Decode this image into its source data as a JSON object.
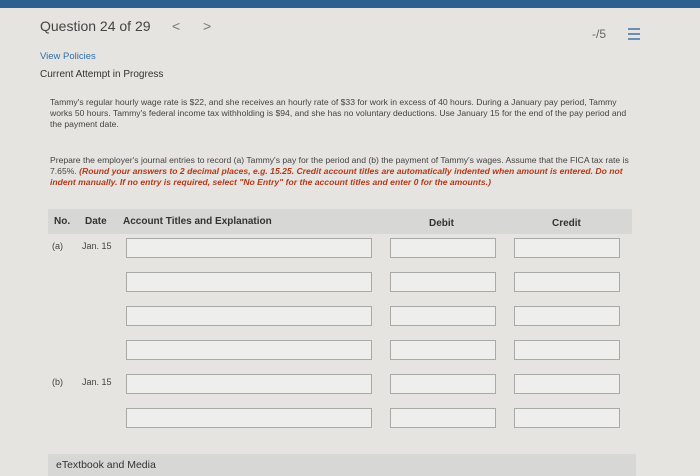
{
  "question": {
    "title": "Question 24 of 29",
    "prev_icon": "<",
    "next_icon": ">",
    "score": "-/5",
    "menu_icon": "list-icon"
  },
  "links": {
    "view_policies": "View Policies"
  },
  "status": {
    "attempt": "Current Attempt in Progress"
  },
  "problem": {
    "paragraph1": "Tammy's regular hourly wage rate is $22, and she receives an hourly rate of $33 for work in excess of 40 hours. During a January pay period, Tammy works 50 hours. Tammy's federal income tax withholding is $94, and she has no voluntary deductions. Use January 15 for the end of the pay period and the payment date.",
    "paragraph2_plain": "Prepare the employer's journal entries to record (a) Tammy's pay for the period and (b) the payment of Tammy's wages. Assume that the FICA tax rate is 7.65%. ",
    "paragraph2_emphasis": "(Round your answers to 2 decimal places, e.g. 15.25. Credit account titles are automatically indented when amount is entered. Do not indent manually. If no entry is required, select \"No Entry\" for the account titles and enter 0 for the amounts.)"
  },
  "table": {
    "headers": {
      "no": "No.",
      "date": "Date",
      "account": "Account Titles and Explanation",
      "debit": "Debit",
      "credit": "Credit"
    },
    "entries": [
      {
        "no": "(a)",
        "date": "Jan. 15"
      },
      {
        "no": "(b)",
        "date": "Jan. 15"
      }
    ]
  },
  "footer": {
    "etextbook": "eTextbook and Media"
  }
}
